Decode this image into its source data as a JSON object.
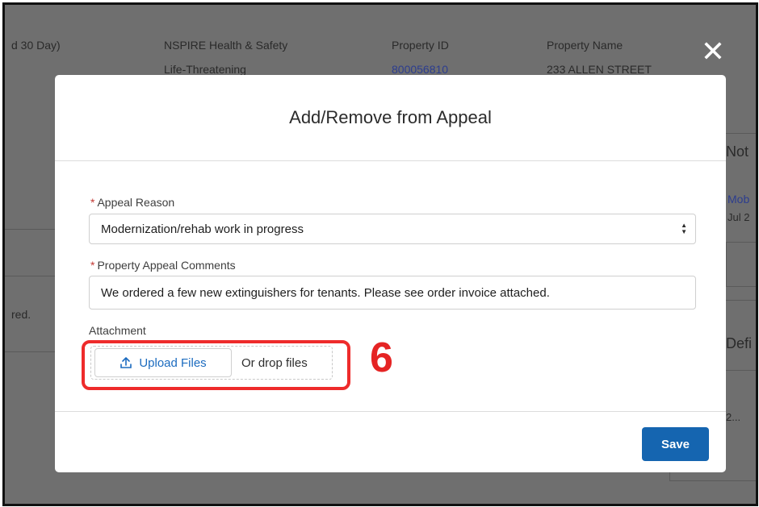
{
  "background": {
    "col_days": "d 30 Day)",
    "col_health_title": "NSPIRE Health & Safety",
    "col_health_value": "Life-Threatening",
    "property_id_label": "Property ID",
    "property_id_value": "800056810",
    "property_name_label": "Property Name",
    "property_name_value": "233 ALLEN STREET",
    "notes_fragment": "Not",
    "mob_fragment": "Mob",
    "jul_fragment": "Jul 2",
    "red_fragment": "red.",
    "defi_fragment": "Defi",
    "ellipsis_fragment": "2..."
  },
  "close_icon": "close-icon",
  "modal": {
    "title": "Add/Remove from Appeal",
    "required_mark": "*",
    "appeal_reason_label": "Appeal Reason",
    "appeal_reason_value": "Modernization/rehab work in progress",
    "comments_label": "Property Appeal Comments",
    "comments_value": "We ordered a few new extinguishers for tenants. Please see order invoice attached.",
    "attachment_label": "Attachment",
    "upload_label": "Upload Files",
    "drop_label": "Or drop files",
    "save_label": "Save"
  },
  "annotation": {
    "step_number": "6",
    "color": "#ee2b2b"
  },
  "colors": {
    "primary_button": "#1565b0",
    "link": "#1b6bbf",
    "required": "#c23934"
  }
}
